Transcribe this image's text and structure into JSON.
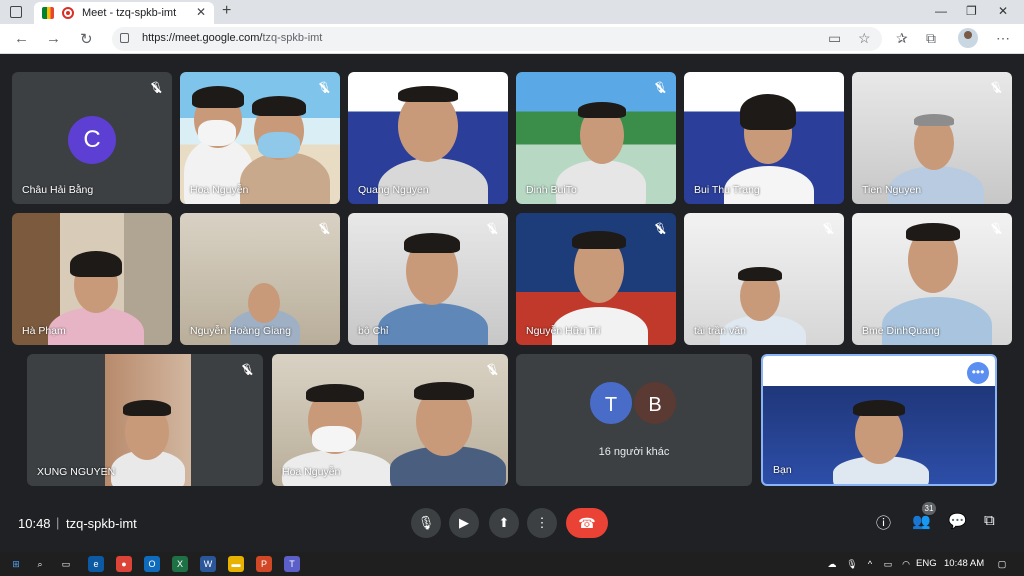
{
  "browser": {
    "tab_title": "Meet - tzq-spkb-imt",
    "tab_close": "✕",
    "new_tab": "+",
    "url_host": "https://meet.google.com/",
    "url_path": "tzq-spkb-imt",
    "window_controls": {
      "minimize": "—",
      "restore": "❐",
      "close": "✕"
    },
    "nav": {
      "back": "←",
      "forward": "→",
      "reload": "↻"
    }
  },
  "participants": [
    {
      "name": "Châu Hải Bằng",
      "avatar_letter": "C"
    },
    {
      "name": "Hoa Nguyễn"
    },
    {
      "name": "Quang Nguyen"
    },
    {
      "name": "Dinh BuiTo"
    },
    {
      "name": "Bui Thu Trang"
    },
    {
      "name": "Tien Nguyen"
    },
    {
      "name": "Hà Phạm"
    },
    {
      "name": "Nguyễn Hoàng Giang"
    },
    {
      "name": "bộ Chỉ"
    },
    {
      "name": "Nguyễn Hữu Trí"
    },
    {
      "name": "tài trần văn"
    },
    {
      "name": "Bme DinhQuang"
    },
    {
      "name": "XUNG NGUYEN"
    },
    {
      "name": "Hoa Nguyễn"
    },
    {
      "name": "Bạn"
    }
  ],
  "others": {
    "label": "16 người khác",
    "avatar_1": "T",
    "avatar_2": "B"
  },
  "self_more": "•••",
  "footer": {
    "time": "10:48",
    "separator": "|",
    "meeting_code": "tzq-spkb-imt",
    "people_count": "31"
  },
  "taskbar": {
    "language": "ENG",
    "time": "10:48 AM"
  },
  "colors": {
    "meet_bg": "#202124",
    "tile_bg": "#3c4043",
    "end_call": "#ea4335",
    "avatar_c": "#5d3fd3",
    "avatar_t": "#4a6cc9",
    "avatar_b": "#5a3a32",
    "self_border": "#8ab4f8"
  }
}
